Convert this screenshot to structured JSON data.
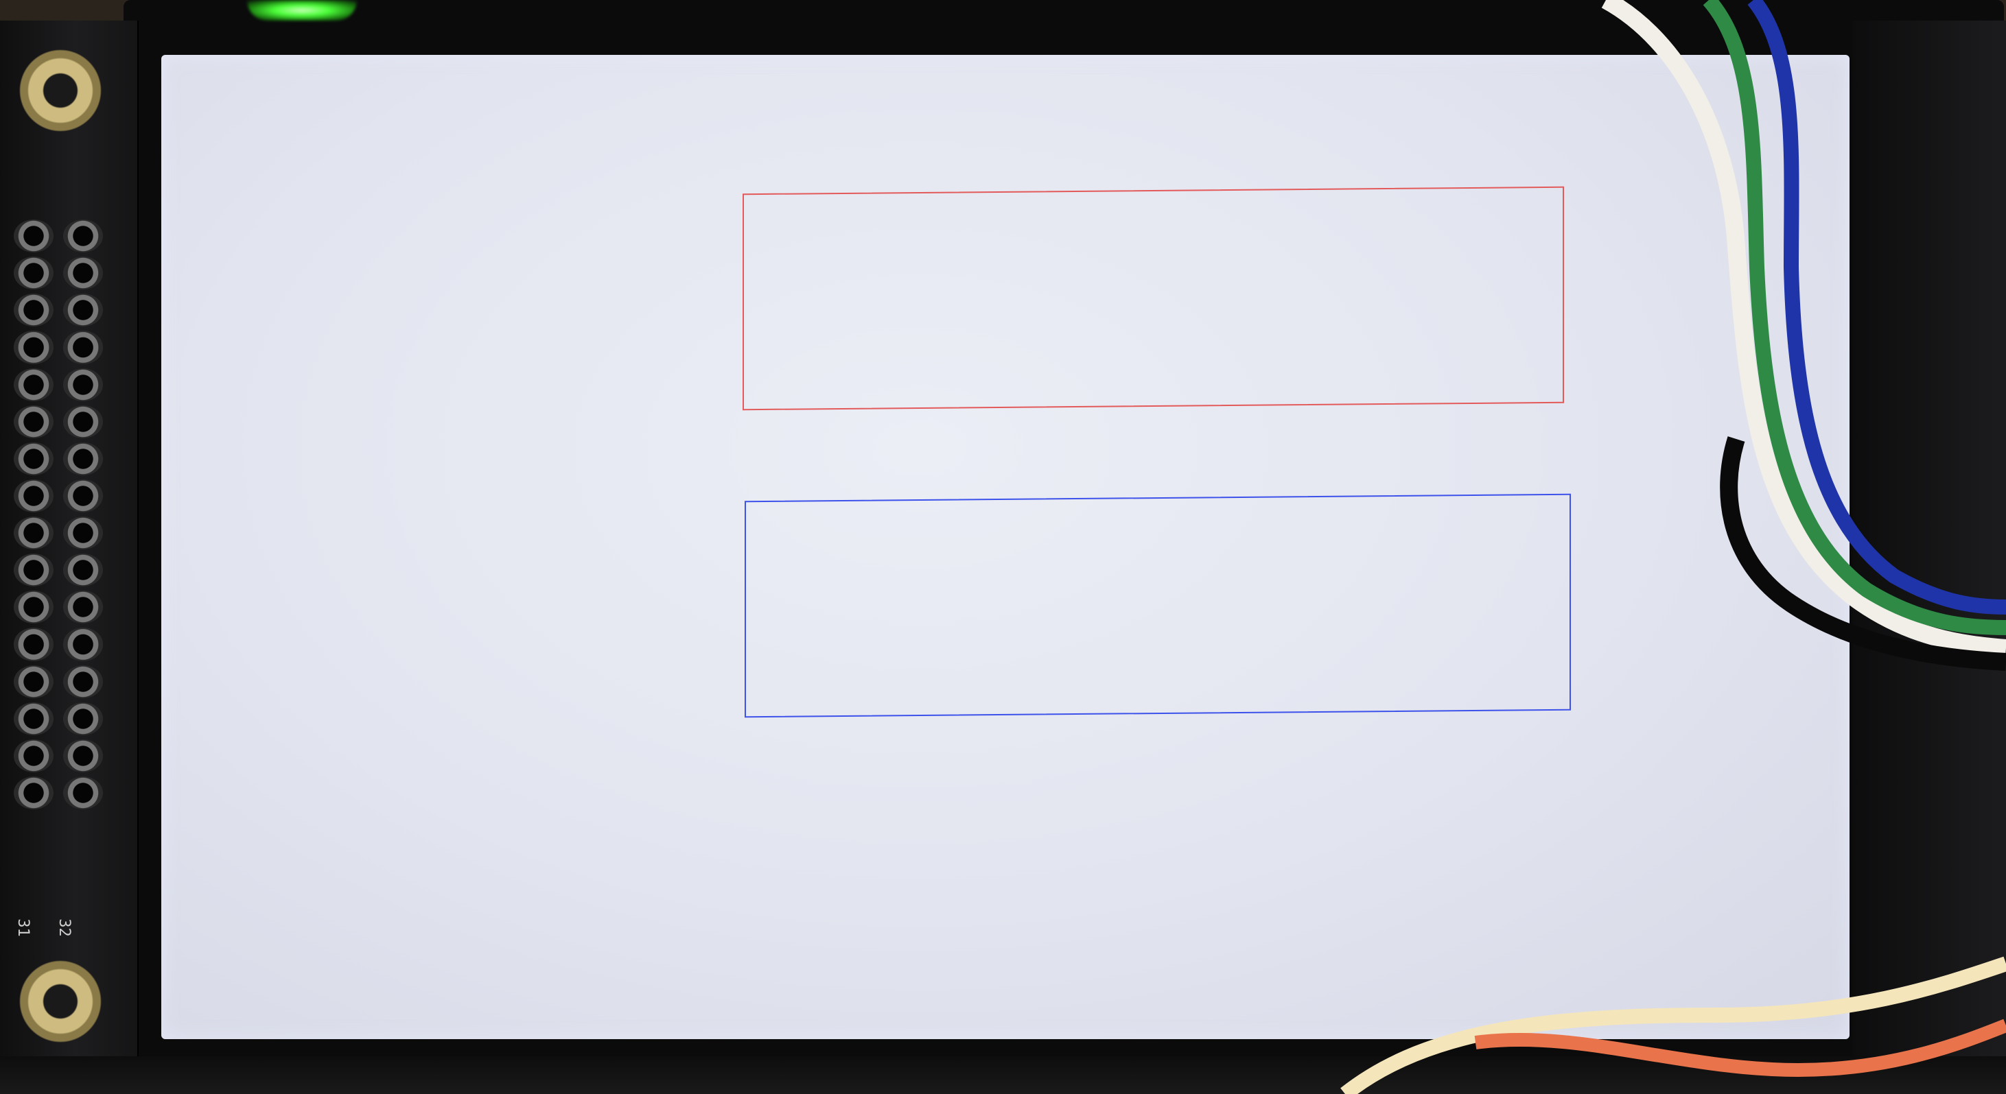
{
  "scene": {
    "description_colors": {
      "screen_background": "#e4e6f1",
      "upper_rectangle_border": "#e35a5a",
      "lower_rectangle_border": "#3d52ea",
      "bezel": "#0b0b0c",
      "status_led": "#4cff3a"
    },
    "pcb": {
      "pin_labels": [
        "31",
        "32"
      ]
    },
    "shapes": {
      "upper_rectangle": "red-outline-rectangle",
      "lower_rectangle": "blue-outline-rectangle"
    },
    "wires": [
      "white",
      "green",
      "blue",
      "black",
      "orange",
      "cream"
    ]
  }
}
